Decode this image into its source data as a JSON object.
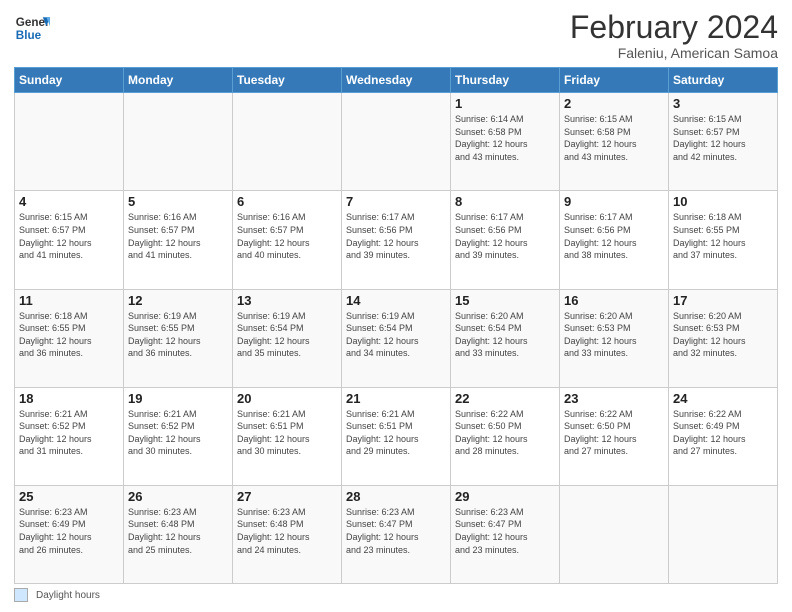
{
  "header": {
    "logo_line1": "General",
    "logo_line2": "Blue",
    "month_title": "February 2024",
    "subtitle": "Faleniu, American Samoa"
  },
  "footer": {
    "legend_label": "Daylight hours"
  },
  "days_of_week": [
    "Sunday",
    "Monday",
    "Tuesday",
    "Wednesday",
    "Thursday",
    "Friday",
    "Saturday"
  ],
  "weeks": [
    [
      {
        "num": "",
        "info": ""
      },
      {
        "num": "",
        "info": ""
      },
      {
        "num": "",
        "info": ""
      },
      {
        "num": "",
        "info": ""
      },
      {
        "num": "1",
        "info": "Sunrise: 6:14 AM\nSunset: 6:58 PM\nDaylight: 12 hours\nand 43 minutes."
      },
      {
        "num": "2",
        "info": "Sunrise: 6:15 AM\nSunset: 6:58 PM\nDaylight: 12 hours\nand 43 minutes."
      },
      {
        "num": "3",
        "info": "Sunrise: 6:15 AM\nSunset: 6:57 PM\nDaylight: 12 hours\nand 42 minutes."
      }
    ],
    [
      {
        "num": "4",
        "info": "Sunrise: 6:15 AM\nSunset: 6:57 PM\nDaylight: 12 hours\nand 41 minutes."
      },
      {
        "num": "5",
        "info": "Sunrise: 6:16 AM\nSunset: 6:57 PM\nDaylight: 12 hours\nand 41 minutes."
      },
      {
        "num": "6",
        "info": "Sunrise: 6:16 AM\nSunset: 6:57 PM\nDaylight: 12 hours\nand 40 minutes."
      },
      {
        "num": "7",
        "info": "Sunrise: 6:17 AM\nSunset: 6:56 PM\nDaylight: 12 hours\nand 39 minutes."
      },
      {
        "num": "8",
        "info": "Sunrise: 6:17 AM\nSunset: 6:56 PM\nDaylight: 12 hours\nand 39 minutes."
      },
      {
        "num": "9",
        "info": "Sunrise: 6:17 AM\nSunset: 6:56 PM\nDaylight: 12 hours\nand 38 minutes."
      },
      {
        "num": "10",
        "info": "Sunrise: 6:18 AM\nSunset: 6:55 PM\nDaylight: 12 hours\nand 37 minutes."
      }
    ],
    [
      {
        "num": "11",
        "info": "Sunrise: 6:18 AM\nSunset: 6:55 PM\nDaylight: 12 hours\nand 36 minutes."
      },
      {
        "num": "12",
        "info": "Sunrise: 6:19 AM\nSunset: 6:55 PM\nDaylight: 12 hours\nand 36 minutes."
      },
      {
        "num": "13",
        "info": "Sunrise: 6:19 AM\nSunset: 6:54 PM\nDaylight: 12 hours\nand 35 minutes."
      },
      {
        "num": "14",
        "info": "Sunrise: 6:19 AM\nSunset: 6:54 PM\nDaylight: 12 hours\nand 34 minutes."
      },
      {
        "num": "15",
        "info": "Sunrise: 6:20 AM\nSunset: 6:54 PM\nDaylight: 12 hours\nand 33 minutes."
      },
      {
        "num": "16",
        "info": "Sunrise: 6:20 AM\nSunset: 6:53 PM\nDaylight: 12 hours\nand 33 minutes."
      },
      {
        "num": "17",
        "info": "Sunrise: 6:20 AM\nSunset: 6:53 PM\nDaylight: 12 hours\nand 32 minutes."
      }
    ],
    [
      {
        "num": "18",
        "info": "Sunrise: 6:21 AM\nSunset: 6:52 PM\nDaylight: 12 hours\nand 31 minutes."
      },
      {
        "num": "19",
        "info": "Sunrise: 6:21 AM\nSunset: 6:52 PM\nDaylight: 12 hours\nand 30 minutes."
      },
      {
        "num": "20",
        "info": "Sunrise: 6:21 AM\nSunset: 6:51 PM\nDaylight: 12 hours\nand 30 minutes."
      },
      {
        "num": "21",
        "info": "Sunrise: 6:21 AM\nSunset: 6:51 PM\nDaylight: 12 hours\nand 29 minutes."
      },
      {
        "num": "22",
        "info": "Sunrise: 6:22 AM\nSunset: 6:50 PM\nDaylight: 12 hours\nand 28 minutes."
      },
      {
        "num": "23",
        "info": "Sunrise: 6:22 AM\nSunset: 6:50 PM\nDaylight: 12 hours\nand 27 minutes."
      },
      {
        "num": "24",
        "info": "Sunrise: 6:22 AM\nSunset: 6:49 PM\nDaylight: 12 hours\nand 27 minutes."
      }
    ],
    [
      {
        "num": "25",
        "info": "Sunrise: 6:23 AM\nSunset: 6:49 PM\nDaylight: 12 hours\nand 26 minutes."
      },
      {
        "num": "26",
        "info": "Sunrise: 6:23 AM\nSunset: 6:48 PM\nDaylight: 12 hours\nand 25 minutes."
      },
      {
        "num": "27",
        "info": "Sunrise: 6:23 AM\nSunset: 6:48 PM\nDaylight: 12 hours\nand 24 minutes."
      },
      {
        "num": "28",
        "info": "Sunrise: 6:23 AM\nSunset: 6:47 PM\nDaylight: 12 hours\nand 23 minutes."
      },
      {
        "num": "29",
        "info": "Sunrise: 6:23 AM\nSunset: 6:47 PM\nDaylight: 12 hours\nand 23 minutes."
      },
      {
        "num": "",
        "info": ""
      },
      {
        "num": "",
        "info": ""
      }
    ]
  ]
}
